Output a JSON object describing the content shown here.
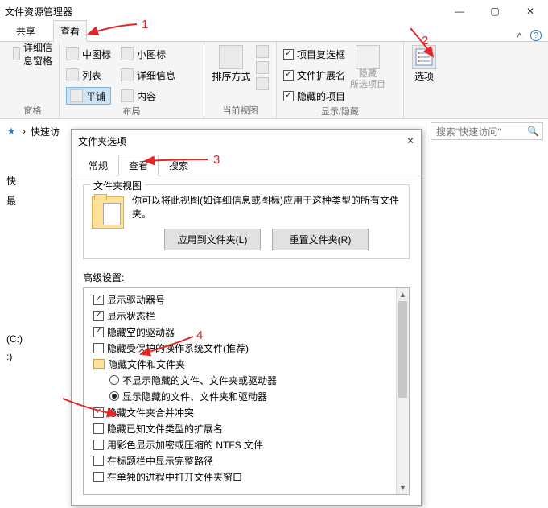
{
  "window": {
    "title": "文件资源管理器"
  },
  "ribbon": {
    "tabs": {
      "share": "共享",
      "view": "查看"
    },
    "pane": {
      "label": "详细信息窗格",
      "groupTitle": "窗格"
    },
    "layout": {
      "mediumIcons": "中图标",
      "smallIcons": "小图标",
      "list": "列表",
      "details": "详细信息",
      "tiles": "平铺",
      "content": "内容",
      "groupTitle": "布局"
    },
    "currentView": {
      "sort": "排序方式",
      "groupTitle": "当前视图"
    },
    "showHide": {
      "itemCheckboxes": "项目复选框",
      "fileExt": "文件扩展名",
      "hiddenItems": "隐藏的项目",
      "hideBtn": "隐藏\n所选项目",
      "hideBtnLine1": "隐藏",
      "hideBtnLine2": "所选项目",
      "groupTitle": "显示/隐藏"
    },
    "options": {
      "label": "选项"
    }
  },
  "breadcrumb": {
    "quickAccess": "快速访",
    "searchPlaceholder": "搜索\"快速访问\""
  },
  "sidebar": {
    "quick": "快",
    "recent": "最",
    "c": "(C:)",
    "d": ":)"
  },
  "dialog": {
    "title": "文件夹选项",
    "tabs": {
      "general": "常规",
      "view": "查看",
      "search": "搜索"
    },
    "folderViews": {
      "legend": "文件夹视图",
      "text": "你可以将此视图(如详细信息或图标)应用于这种类型的所有文件夹。",
      "applyBtn": "应用到文件夹(L)",
      "resetBtn": "重置文件夹(R)"
    },
    "advLabel": "高级设置:",
    "adv": [
      {
        "kind": "check",
        "checked": true,
        "indent": false,
        "label": "显示驱动器号"
      },
      {
        "kind": "check",
        "checked": true,
        "indent": false,
        "label": "显示状态栏"
      },
      {
        "kind": "check",
        "checked": true,
        "indent": false,
        "label": "隐藏空的驱动器"
      },
      {
        "kind": "check",
        "checked": false,
        "indent": false,
        "label": "隐藏受保护的操作系统文件(推荐)"
      },
      {
        "kind": "folder",
        "checked": false,
        "indent": false,
        "label": "隐藏文件和文件夹"
      },
      {
        "kind": "radio",
        "checked": false,
        "indent": true,
        "label": "不显示隐藏的文件、文件夹或驱动器"
      },
      {
        "kind": "radio",
        "checked": true,
        "indent": true,
        "label": "显示隐藏的文件、文件夹和驱动器"
      },
      {
        "kind": "check",
        "checked": true,
        "indent": false,
        "label": "隐藏文件夹合并冲突"
      },
      {
        "kind": "check",
        "checked": false,
        "indent": false,
        "label": "隐藏已知文件类型的扩展名"
      },
      {
        "kind": "check",
        "checked": false,
        "indent": false,
        "label": "用彩色显示加密或压缩的 NTFS 文件"
      },
      {
        "kind": "check",
        "checked": false,
        "indent": false,
        "label": "在标题栏中显示完整路径"
      },
      {
        "kind": "check",
        "checked": false,
        "indent": false,
        "label": "在单独的进程中打开文件夹窗口"
      }
    ]
  },
  "annotations": {
    "a1": "1",
    "a2": "2",
    "a3": "3",
    "a4": "4"
  },
  "colors": {
    "arrow": "#e52525"
  }
}
